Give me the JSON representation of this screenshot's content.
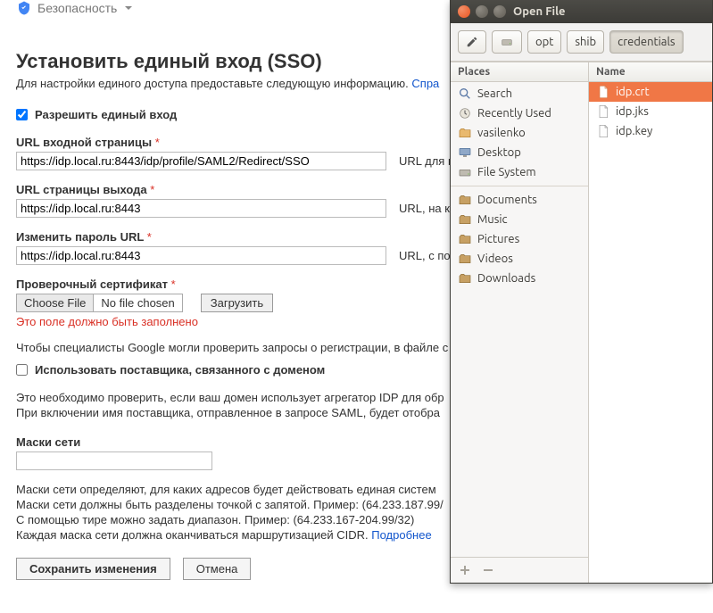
{
  "breadcrumb": {
    "label": "Безопасность"
  },
  "page": {
    "title": "Установить единый вход (SSO)",
    "subtitle_prefix": "Для настройки единого доступа предоставьте следующую информацию. ",
    "subtitle_link": "Спра"
  },
  "sso": {
    "enable_label": "Разрешить единый вход",
    "enable_checked": true,
    "signin": {
      "label": "URL входной страницы",
      "value": "https://idp.local.ru:8443/idp/profile/SAML2/Redirect/SSO",
      "hint": "URL для в"
    },
    "signout": {
      "label": "URL страницы выхода",
      "value": "https://idp.local.ru:8443",
      "hint": "URL, на ко"
    },
    "changepw": {
      "label": "Изменить пароль URL",
      "value": "https://idp.local.ru:8443",
      "hint": "URL, с пом"
    },
    "cert": {
      "label": "Проверочный сертификат",
      "choose_btn": "Choose File",
      "status": "No file chosen",
      "upload_btn": "Загрузить",
      "error": "Это поле должно быть заполнено"
    },
    "help_line": "Чтобы специалисты Google могли проверить запросы о регистрации, в файле с",
    "domain_issuer": {
      "label": "Использовать поставщика, связанного с доменом",
      "checked": false,
      "desc_line1": "Это необходимо проверить, если ваш домен использует агрегатор IDP для обр",
      "desc_line2": "При включении имя поставщика, отправленное в запросе SAML, будет отобра"
    },
    "netmask": {
      "label": "Маски сети",
      "value": "",
      "desc1": "Маски сети определяют, для каких адресов будет действовать единая систем",
      "desc2": "Маски сети должны быть разделены точкой с запятой. Пример: (64.233.187.99/",
      "desc3": "С помощью тире можно задать диапазон. Пример: (64.233.167-204.99/32)",
      "desc4_prefix": "Каждая маска сети должна оканчиваться маршрутизацией CIDR. ",
      "desc4_link": "Подробнее"
    },
    "actions": {
      "save": "Сохранить изменения",
      "cancel": "Отмена"
    }
  },
  "dialog": {
    "title": "Open File",
    "path_crumbs": [
      "opt",
      "shib",
      "credentials"
    ],
    "places_header": "Places",
    "files_header": "Name",
    "places": {
      "search": "Search",
      "recent": "Recently Used",
      "home": "vasilenko",
      "desktop": "Desktop",
      "filesystem": "File System",
      "documents": "Documents",
      "music": "Music",
      "pictures": "Pictures",
      "videos": "Videos",
      "downloads": "Downloads"
    },
    "files": [
      {
        "name": "idp.crt",
        "selected": true
      },
      {
        "name": "idp.jks",
        "selected": false
      },
      {
        "name": "idp.key",
        "selected": false
      }
    ]
  }
}
